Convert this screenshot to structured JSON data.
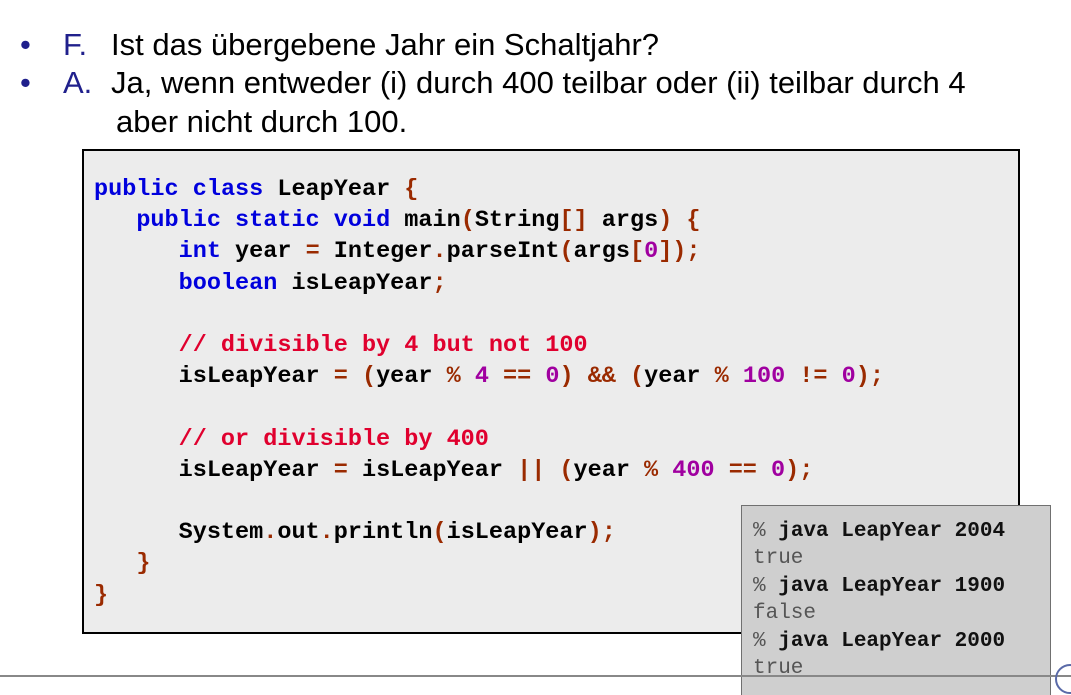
{
  "qa": [
    {
      "bullet": "•",
      "marker": "F.",
      "lines": [
        "Ist das übergebene Jahr ein Schaltjahr?"
      ]
    },
    {
      "bullet": "•",
      "marker": "A.",
      "lines": [
        "Ja, wenn entweder (i) durch 400 teilbar oder (ii) teilbar durch 4",
        "aber nicht durch 100."
      ]
    }
  ],
  "code": {
    "colors": {
      "keyword": "#0000dd",
      "comment": "#e0002e",
      "number": "#a000a0",
      "operator": "#9a2a00",
      "text": "#000000",
      "background": "#ececec"
    },
    "lines": [
      [
        [
          "kw",
          "public"
        ],
        [
          "tx",
          " "
        ],
        [
          "kw",
          "class"
        ],
        [
          "tx",
          " LeapYear "
        ],
        [
          "pn",
          "{"
        ]
      ],
      [
        [
          "tx",
          "   "
        ],
        [
          "kw",
          "public"
        ],
        [
          "tx",
          " "
        ],
        [
          "kw",
          "static"
        ],
        [
          "tx",
          " "
        ],
        [
          "kw",
          "void"
        ],
        [
          "tx",
          " main"
        ],
        [
          "pn",
          "("
        ],
        [
          "tx",
          "String"
        ],
        [
          "pn",
          "[]"
        ],
        [
          "tx",
          " args"
        ],
        [
          "pn",
          ")"
        ],
        [
          "tx",
          " "
        ],
        [
          "pn",
          "{"
        ]
      ],
      [
        [
          "tx",
          "      "
        ],
        [
          "kw",
          "int"
        ],
        [
          "tx",
          " year "
        ],
        [
          "op",
          "="
        ],
        [
          "tx",
          " Integer"
        ],
        [
          "op",
          "."
        ],
        [
          "tx",
          "parseInt"
        ],
        [
          "pn",
          "("
        ],
        [
          "tx",
          "args"
        ],
        [
          "pn",
          "["
        ],
        [
          "nm",
          "0"
        ],
        [
          "pn",
          "]);"
        ]
      ],
      [
        [
          "tx",
          "      "
        ],
        [
          "kw",
          "boolean"
        ],
        [
          "tx",
          " isLeapYear"
        ],
        [
          "pn",
          ";"
        ]
      ],
      [],
      [
        [
          "tx",
          "      "
        ],
        [
          "cm",
          "// divisible by 4 but not 100"
        ]
      ],
      [
        [
          "tx",
          "      isLeapYear "
        ],
        [
          "op",
          "="
        ],
        [
          "tx",
          " "
        ],
        [
          "pn",
          "("
        ],
        [
          "tx",
          "year "
        ],
        [
          "op",
          "%"
        ],
        [
          "tx",
          " "
        ],
        [
          "nm",
          "4"
        ],
        [
          "tx",
          " "
        ],
        [
          "op",
          "=="
        ],
        [
          "tx",
          " "
        ],
        [
          "nm",
          "0"
        ],
        [
          "pn",
          ")"
        ],
        [
          "tx",
          " "
        ],
        [
          "op",
          "&&"
        ],
        [
          "tx",
          " "
        ],
        [
          "pn",
          "("
        ],
        [
          "tx",
          "year "
        ],
        [
          "op",
          "%"
        ],
        [
          "tx",
          " "
        ],
        [
          "nm",
          "100"
        ],
        [
          "tx",
          " "
        ],
        [
          "op",
          "!="
        ],
        [
          "tx",
          " "
        ],
        [
          "nm",
          "0"
        ],
        [
          "pn",
          ");"
        ]
      ],
      [],
      [
        [
          "tx",
          "      "
        ],
        [
          "cm",
          "// or divisible by 400"
        ]
      ],
      [
        [
          "tx",
          "      isLeapYear "
        ],
        [
          "op",
          "="
        ],
        [
          "tx",
          " isLeapYear "
        ],
        [
          "op",
          "||"
        ],
        [
          "tx",
          " "
        ],
        [
          "pn",
          "("
        ],
        [
          "tx",
          "year "
        ],
        [
          "op",
          "%"
        ],
        [
          "tx",
          " "
        ],
        [
          "nm",
          "400"
        ],
        [
          "tx",
          " "
        ],
        [
          "op",
          "=="
        ],
        [
          "tx",
          " "
        ],
        [
          "nm",
          "0"
        ],
        [
          "pn",
          ");"
        ]
      ],
      [],
      [
        [
          "tx",
          "      System"
        ],
        [
          "op",
          "."
        ],
        [
          "tx",
          "out"
        ],
        [
          "op",
          "."
        ],
        [
          "tx",
          "println"
        ],
        [
          "pn",
          "("
        ],
        [
          "tx",
          "isLeapYear"
        ],
        [
          "pn",
          ");"
        ]
      ],
      [
        [
          "tx",
          "   "
        ],
        [
          "pn",
          "}"
        ]
      ],
      [
        [
          "pn",
          "}"
        ]
      ]
    ]
  },
  "console": {
    "prompt": "%",
    "runs": [
      {
        "command": "java LeapYear 2004",
        "output": "true"
      },
      {
        "command": "java LeapYear 1900",
        "output": "false"
      },
      {
        "command": "java LeapYear 2000",
        "output": "true"
      }
    ]
  }
}
